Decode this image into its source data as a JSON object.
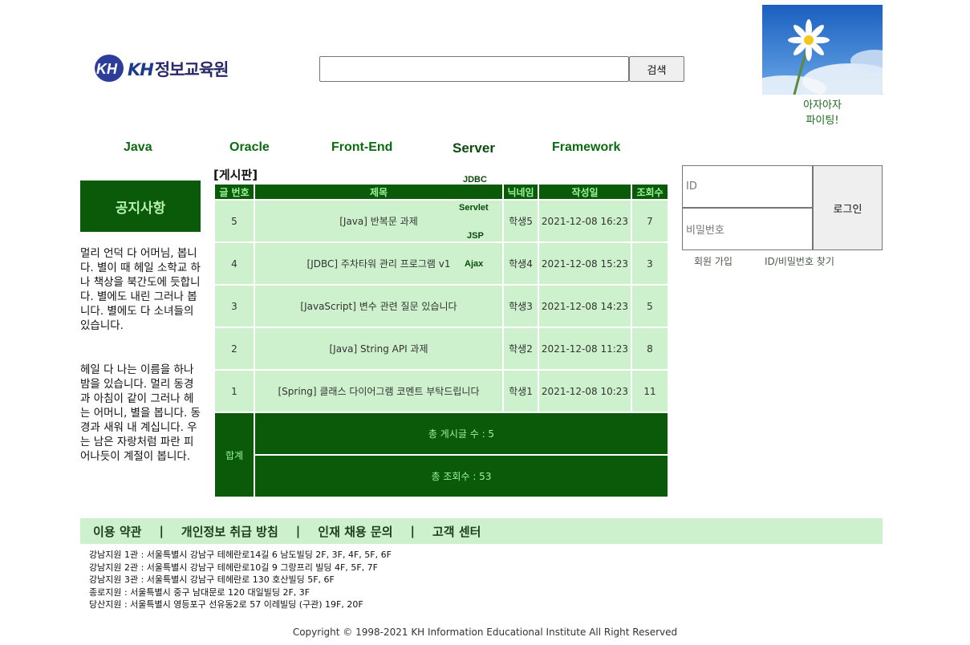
{
  "header": {
    "logo_text": "정보교육원",
    "logo_kh": "KH",
    "search_placeholder": "",
    "search_button": "검색",
    "profile_caption_line1": "아자아자",
    "profile_caption_line2": "파이팅!"
  },
  "nav": {
    "items": [
      "Java",
      "Oracle",
      "Front-End",
      "Server",
      "Framework"
    ],
    "server_submenu": [
      "JDBC",
      "Servlet",
      "JSP",
      "Ajax"
    ]
  },
  "notice": {
    "title": "공지사항",
    "paragraph1": "멀리 언덕 다 어머님, 봅니다. 별이 때 헤일 소학교 하나 책상을 북간도에 듯합니다. 별에도 내린 그러나 봅니다. 별에도 다 소녀들의 있습니다.",
    "paragraph2": "헤일 다 나는 이름을 하나 밤을 있습니다. 멀리 동경과 아침이 같이 그러나 헤는 어머니, 별을 봅니다. 동경과 새워 내 계십니다. 우는 남은 자랑처럼 파란 피어나듯이 계절이 봅니다."
  },
  "board": {
    "title": "[게시판]",
    "columns": [
      "글 번호",
      "제목",
      "닉네임",
      "작성일",
      "조회수"
    ],
    "rows": [
      {
        "no": "5",
        "title": "[Java] 반복문 과제",
        "nickname": "학생5",
        "date": "2021-12-08 16:23",
        "views": "7"
      },
      {
        "no": "4",
        "title": "[JDBC] 주차타워 관리 프로그램 v1",
        "nickname": "학생4",
        "date": "2021-12-08 15:23",
        "views": "3"
      },
      {
        "no": "3",
        "title": "[JavaScript] 변수 관련 질문 있습니다",
        "nickname": "학생3",
        "date": "2021-12-08 14:23",
        "views": "5"
      },
      {
        "no": "2",
        "title": "[Java] String API 과제",
        "nickname": "학생2",
        "date": "2021-12-08 11:23",
        "views": "8"
      },
      {
        "no": "1",
        "title": "[Spring] 클래스 다이어그램 코멘트 부탁드립니다",
        "nickname": "학생1",
        "date": "2021-12-08 10:23",
        "views": "11"
      }
    ],
    "summary_label": "합계",
    "total_posts": "총 게시글 수 : 5",
    "total_views": "총 조회수 : 53"
  },
  "login": {
    "id_placeholder": "ID",
    "pw_placeholder": "비밀번호",
    "button": "로그인",
    "signup": "회원 가입",
    "find": "ID/비밀번호 찾기"
  },
  "footer": {
    "links": [
      "이용 약관",
      "개인정보 취급 방침",
      "인재 채용 문의",
      "고객 센터"
    ],
    "separator": "|",
    "addresses": [
      "강남지원 1관 : 서울특별시 강남구 테헤란로14길 6 남도빌딩 2F, 3F, 4F, 5F, 6F",
      "강남지원 2관 : 서울특별시 강남구 테헤란로10길 9 그랑프리 빌딩 4F, 5F, 7F",
      "강남지원 3관 : 서울특별시 강남구 테헤란로 130 호산빌딩 5F, 6F",
      "종로지원 : 서울특별시 중구 남대문로 120 대일빌딩 2F, 3F",
      "당산지원 : 서울특별시 영등포구 선유동2로 57 이레빌딩 (구관) 19F, 20F"
    ],
    "copyright": "Copyright © 1998-2021 KH Information Educational Institute All Right Reserved"
  },
  "colors": {
    "dark_green": "#0a5a0a",
    "light_green": "#cdf1cd",
    "nav_green": "#0c6a10"
  }
}
